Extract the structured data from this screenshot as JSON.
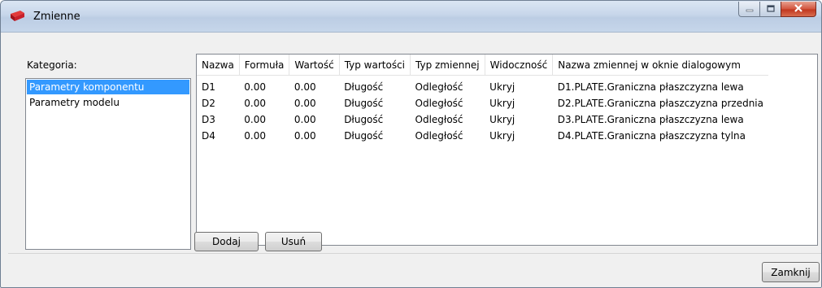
{
  "window": {
    "title": "Zmienne"
  },
  "category": {
    "label": "Kategoria:",
    "items": [
      "Parametry komponentu",
      "Parametry modelu"
    ],
    "selected_index": 0
  },
  "table": {
    "columns": [
      "Nazwa",
      "Formuła",
      "Wartość",
      "Typ wartości",
      "Typ zmiennej",
      "Widoczność",
      "Nazwa zmiennej w oknie dialogowym"
    ],
    "rows": [
      [
        "D1",
        "0.00",
        "0.00",
        "Długość",
        "Odległość",
        "Ukryj",
        "D1.PLATE.Graniczna płaszczyzna lewa"
      ],
      [
        "D2",
        "0.00",
        "0.00",
        "Długość",
        "Odległość",
        "Ukryj",
        "D2.PLATE.Graniczna płaszczyzna przednia"
      ],
      [
        "D3",
        "0.00",
        "0.00",
        "Długość",
        "Odległość",
        "Ukryj",
        "D3.PLATE.Graniczna płaszczyzna lewa"
      ],
      [
        "D4",
        "0.00",
        "0.00",
        "Długość",
        "Odległość",
        "Ukryj",
        "D4.PLATE.Graniczna płaszczyzna tylna"
      ]
    ]
  },
  "buttons": {
    "add": "Dodaj",
    "remove": "Usuń",
    "close": "Zamknij"
  },
  "icons": {
    "app": "red-plate-icon",
    "minimize": "minimize-icon",
    "maximize": "maximize-icon",
    "close": "close-icon"
  },
  "colors": {
    "selection": "#3399ff",
    "close_button": "#c1371f",
    "app_icon": "#c8202a"
  }
}
